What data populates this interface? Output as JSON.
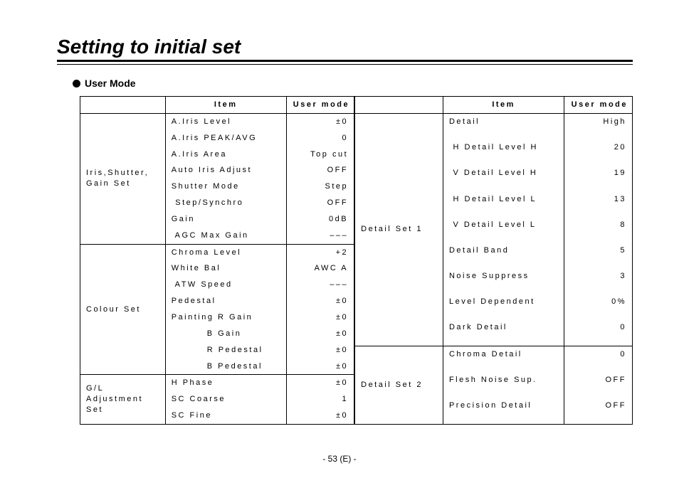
{
  "title": "Setting to initial set",
  "section": "User Mode",
  "pagenum": "- 53 (E) -",
  "headers": {
    "cat": "",
    "item": "Item",
    "val": "User mode"
  },
  "t1": {
    "groups": [
      {
        "category": "Iris,Shutter,\nGain Set",
        "rows": [
          {
            "item": "A.Iris Level",
            "val": "±0"
          },
          {
            "item": "A.Iris PEAK/AVG",
            "val": "0"
          },
          {
            "item": "A.Iris Area",
            "val": "Top cut"
          },
          {
            "item": "Auto Iris Adjust",
            "val": "OFF"
          },
          {
            "item": "Shutter Mode",
            "val": "Step"
          },
          {
            "item": " Step/Synchro",
            "val": "OFF"
          },
          {
            "item": "Gain",
            "val": "0dB"
          },
          {
            "item": " AGC Max Gain",
            "val": "–––"
          }
        ]
      },
      {
        "category": "Colour Set",
        "rows": [
          {
            "item": "Chroma Level",
            "val": "+2"
          },
          {
            "item": "White Bal",
            "val": "AWC A"
          },
          {
            "item": " ATW Speed",
            "val": "–––"
          },
          {
            "item": "Pedestal",
            "val": "±0"
          },
          {
            "item": "Painting R Gain",
            "val": "±0"
          },
          {
            "item": "         B Gain",
            "val": "±0"
          },
          {
            "item": "         R Pedestal",
            "val": "±0"
          },
          {
            "item": "         B Pedestal",
            "val": "±0"
          }
        ]
      },
      {
        "category": "G/L\nAdjustment\nSet",
        "rows": [
          {
            "item": "H Phase",
            "val": "±0"
          },
          {
            "item": "SC Coarse",
            "val": "1"
          },
          {
            "item": "SC Fine",
            "val": "±0"
          }
        ]
      }
    ]
  },
  "t2": {
    "groups": [
      {
        "category": "Detail Set 1",
        "rows": [
          {
            "item": "Detail",
            "val": "High"
          },
          {
            "item": " H Detail Level H",
            "val": "20"
          },
          {
            "item": " V Detail Level H",
            "val": "19"
          },
          {
            "item": " H Detail Level L",
            "val": "13"
          },
          {
            "item": " V Detail Level L",
            "val": "8"
          },
          {
            "item": "Detail Band",
            "val": "5"
          },
          {
            "item": "Noise Suppress",
            "val": "3"
          },
          {
            "item": "Level Dependent",
            "val": "0%"
          },
          {
            "item": "Dark Detail",
            "val": "0"
          }
        ]
      },
      {
        "category": "Detail Set 2",
        "rows": [
          {
            "item": "Chroma Detail",
            "val": "0"
          },
          {
            "item": "Flesh Noise Sup.",
            "val": "OFF"
          },
          {
            "item": "Precision Detail",
            "val": "OFF"
          }
        ]
      }
    ]
  }
}
